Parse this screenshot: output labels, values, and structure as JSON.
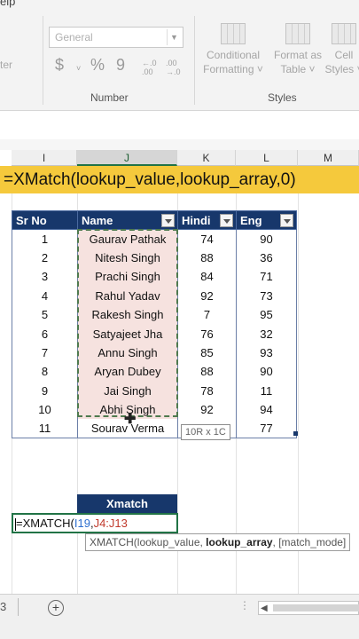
{
  "ribbon": {
    "help_tab": "elp",
    "left_partial": "ter",
    "number_format": {
      "value": "General"
    },
    "currency_symbol": "$",
    "percent_symbol": "%",
    "comma_symbol": "9",
    "inc_decimal": "←.0\n.00",
    "dec_decimal": ".00\n→.0",
    "number_group_label": "Number",
    "styles_group_label": "Styles",
    "conditional_formatting": {
      "line1": "Conditional",
      "line2": "Formatting ˅"
    },
    "format_as_table": {
      "line1": "Format as",
      "line2": "Table ˅"
    },
    "cell_styles": {
      "line1": "Cell",
      "line2": "Styles ˅"
    }
  },
  "columns": [
    "I",
    "J",
    "K",
    "L",
    "M"
  ],
  "callout": "=XMatch(lookup_value,lookup_array,0)",
  "table": {
    "headers": [
      "Sr No",
      "Name",
      "Hindi",
      "Eng"
    ],
    "rows": [
      [
        "1",
        "Gaurav Pathak",
        "74",
        "90"
      ],
      [
        "2",
        "Nitesh Singh",
        "88",
        "36"
      ],
      [
        "3",
        "Prachi Singh",
        "84",
        "71"
      ],
      [
        "4",
        "Rahul Yadav",
        "92",
        "73"
      ],
      [
        "5",
        "Rakesh Singh",
        "7",
        "95"
      ],
      [
        "6",
        "Satyajeet Jha",
        "76",
        "32"
      ],
      [
        "7",
        "Annu Singh",
        "85",
        "93"
      ],
      [
        "8",
        "Aryan Dubey",
        "88",
        "90"
      ],
      [
        "9",
        "Jai Singh",
        "78",
        "11"
      ],
      [
        "10",
        "Abhi Singh",
        "92",
        "94"
      ],
      [
        "11",
        "Sourav Verma",
        "",
        "77"
      ]
    ]
  },
  "selection_size_tip": "10R x 1C",
  "xmatch": {
    "header": "Xmatch",
    "formula_prefix": "=XMATCH(",
    "ref1": "I19",
    "comma": ",",
    "ref2": "J4:J13",
    "tooltip_pre": "XMATCH(lookup_value, ",
    "tooltip_bold": "lookup_array",
    "tooltip_post": ", [match_mode]"
  },
  "bottom_bar": {
    "sheet_partial": "3",
    "add_sheet": "+",
    "dots": "⋮",
    "scroll_left": "◀"
  }
}
